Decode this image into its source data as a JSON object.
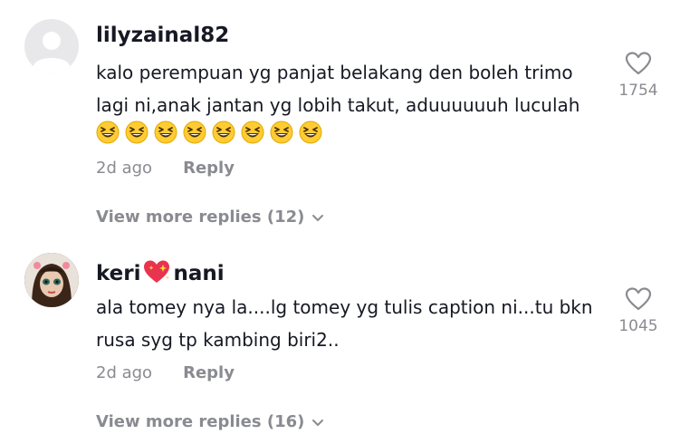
{
  "comments": [
    {
      "username": "lilyzainal82",
      "text": "kalo perempuan yg panjat belakang den boleh trimo lagi ni,anak jantan yg lobih takut, aduuuuuuh luculah",
      "emojis": [
        "laughing-squint-icon",
        "laughing-squint-icon",
        "laughing-squint-icon",
        "laughing-squint-icon",
        "laughing-squint-icon",
        "laughing-squint-icon",
        "laughing-squint-icon",
        "laughing-squint-icon"
      ],
      "time": "2d ago",
      "reply_label": "Reply",
      "likes": "1754",
      "more_replies": "View more replies (12)"
    },
    {
      "username_before": "keri",
      "username_emoji": "sparkling-heart-icon",
      "username_after": "nani",
      "text": "ala tomey nya la....lg tomey yg tulis caption ni...tu bkn rusa syg tp kambing biri2..",
      "time": "2d ago",
      "reply_label": "Reply",
      "likes": "1045",
      "more_replies": "View more replies (16)"
    }
  ],
  "colors": {
    "primary_text": "#161823",
    "secondary_text": "#8a8b91"
  }
}
